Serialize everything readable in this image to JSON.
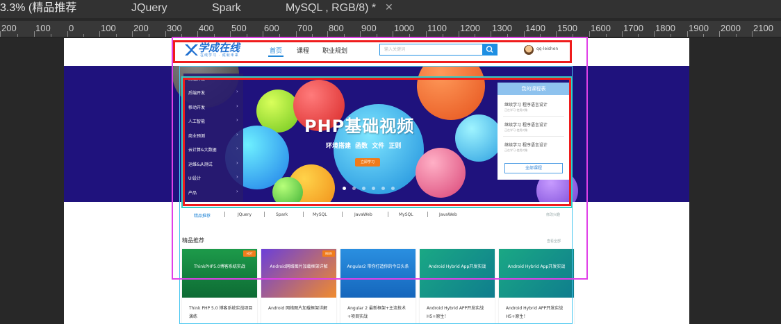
{
  "tabs": [
    {
      "label": "3.3% (精品推荐"
    },
    {
      "label": "JQuery"
    },
    {
      "label": "Spark"
    },
    {
      "label": "MySQL , RGB/8) *"
    }
  ],
  "ruler": {
    "labels": [
      "200",
      "100",
      "0",
      "100",
      "200",
      "300",
      "400",
      "500",
      "600",
      "700",
      "800",
      "900",
      "1000",
      "1100",
      "1200",
      "1300",
      "1400",
      "1500",
      "1600",
      "1700",
      "1800",
      "1900",
      "2000",
      "2100"
    ]
  },
  "site": {
    "logo_text": "学成在线",
    "logo_sub": "在线学习 · 成就未来",
    "nav": [
      "首页",
      "课程",
      "职业规划"
    ],
    "search_placeholder": "输入关键词",
    "username": "qq-leishen",
    "side_menu": [
      "前端开发",
      "后端开发",
      "移动开发",
      "人工智能",
      "商业预测",
      "云计算&大数据",
      "运维&从测试",
      "UI设计",
      "产品"
    ],
    "banner_title": "PHP基础视频",
    "banner_sub": "环境搭建  函数  文件  正则",
    "banner_btn": "立即学习",
    "course_panel": {
      "head": "我的课程表",
      "items": [
        {
          "title": "继续学习 程序语言设计",
          "sub": "正在学习-使用对象"
        },
        {
          "title": "继续学习 程序语言设计",
          "sub": "正在学习-使用对象"
        },
        {
          "title": "继续学习 程序语言设计",
          "sub": "正在学习-使用对象"
        }
      ],
      "all": "全部课程"
    },
    "categories": [
      "精品推荐",
      "JQuery",
      "Spark",
      "MySQL",
      "JavaWeb",
      "MySQL",
      "JavaWeb"
    ],
    "cat_more": "修改兴趣",
    "section_title": "精品推荐",
    "section_more": "查看全部",
    "cards": [
      {
        "img_text": "ThinkPHP5.0博客系统实战",
        "title": "Think PHP 5.0 博客系统实战项目演练",
        "hot": "HOT"
      },
      {
        "img_text": "Android网络图片加载框架详解",
        "title": "Android 网络图片加载框架详解",
        "hot": "NEW"
      },
      {
        "img_text": "Angular2 带你打造你的今日头条",
        "title": "Angular 2 最新框架+主流技术+项目实战",
        "hot": ""
      },
      {
        "img_text": "Android Hybrid App开发实战",
        "title": "Android Hybrid APP开发实战 H5+原生！",
        "hot": ""
      },
      {
        "img_text": "Android Hybrid App开发实战",
        "title": "Android Hybrid APP开发实战 H5+原生！",
        "hot": ""
      }
    ]
  },
  "colors": {
    "banner_bg": "#1f127d",
    "brand": "#1e84d6",
    "guide_magenta": "#e040e8",
    "guide_red": "#ef1c1c",
    "guide_teal": "#31d0c8"
  }
}
